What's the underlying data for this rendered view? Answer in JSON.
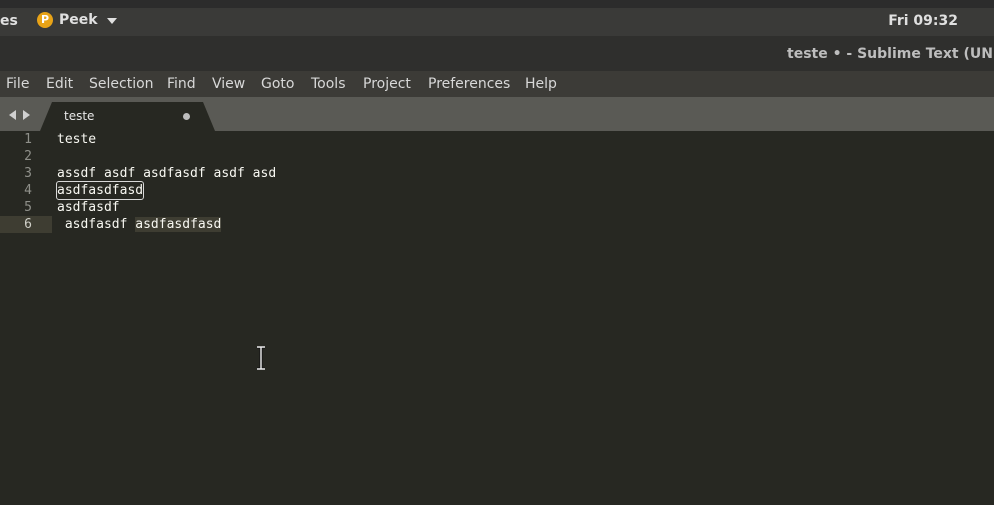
{
  "topbar": {
    "activities_label": "es",
    "app_name": "Peek",
    "app_icon_letter": "P",
    "clock": "Fri 09:32"
  },
  "window": {
    "title": "teste • - Sublime Text (UNREG"
  },
  "menu": {
    "items": [
      "File",
      "Edit",
      "Selection",
      "Find",
      "View",
      "Goto",
      "Tools",
      "Project",
      "Preferences",
      "Help"
    ]
  },
  "tabs": {
    "active_label": "teste"
  },
  "editor": {
    "line_numbers": [
      "1",
      "2",
      "3",
      "4",
      "5",
      "6"
    ],
    "lines": [
      "teste",
      "",
      "assdf asdf asdfasdf asdf asd",
      "asdfasdfasd",
      "asdfasdf",
      " asdfasdf ",
      "asdfasdfasd"
    ]
  },
  "colors": {
    "editor_bg": "#272822",
    "accent": "#e8a317"
  },
  "icons": [
    "peek-logo-icon",
    "chevron-down-icon",
    "tab-left-arrow-icon",
    "tab-right-arrow-icon",
    "unsaved-dot-icon",
    "text-cursor-icon"
  ]
}
